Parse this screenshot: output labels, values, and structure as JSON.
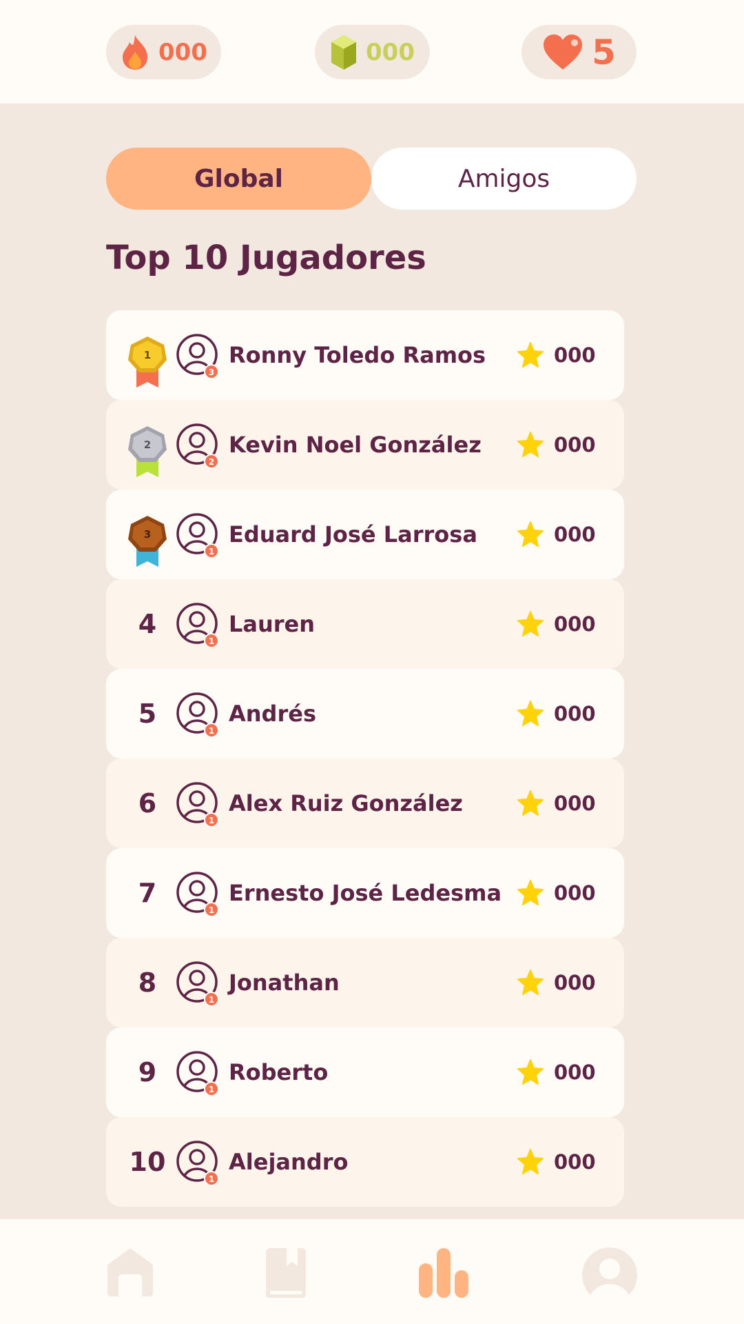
{
  "topbar": {
    "streak": "000",
    "gems": "000",
    "lives": "5"
  },
  "tabs": {
    "global": "Global",
    "friends": "Amigos"
  },
  "heading": "Top 10 Jugadores",
  "players": [
    {
      "rank": "1",
      "name": "Ronny Toledo Ramos",
      "level": "3",
      "score": "000"
    },
    {
      "rank": "2",
      "name": "Kevin Noel González",
      "level": "2",
      "score": "000"
    },
    {
      "rank": "3",
      "name": "Eduard José Larrosa",
      "level": "1",
      "score": "000"
    },
    {
      "rank": "4",
      "name": "Lauren",
      "level": "1",
      "score": "000"
    },
    {
      "rank": "5",
      "name": "Andrés",
      "level": "1",
      "score": "000"
    },
    {
      "rank": "6",
      "name": "Alex Ruiz González",
      "level": "1",
      "score": "000"
    },
    {
      "rank": "7",
      "name": "Ernesto José Ledesma",
      "level": "1",
      "score": "000"
    },
    {
      "rank": "8",
      "name": "Jonathan",
      "level": "1",
      "score": "000"
    },
    {
      "rank": "9",
      "name": "Roberto",
      "level": "1",
      "score": "000"
    },
    {
      "rank": "10",
      "name": "Alejandro",
      "level": "1",
      "score": "000"
    }
  ],
  "colors": {
    "accent": "#ffb481",
    "text": "#5e2446",
    "star": "#ffd20a",
    "badge": "#f36f4d"
  },
  "nav": [
    "home-icon",
    "book-icon",
    "leaderboard-icon",
    "profile-icon"
  ]
}
